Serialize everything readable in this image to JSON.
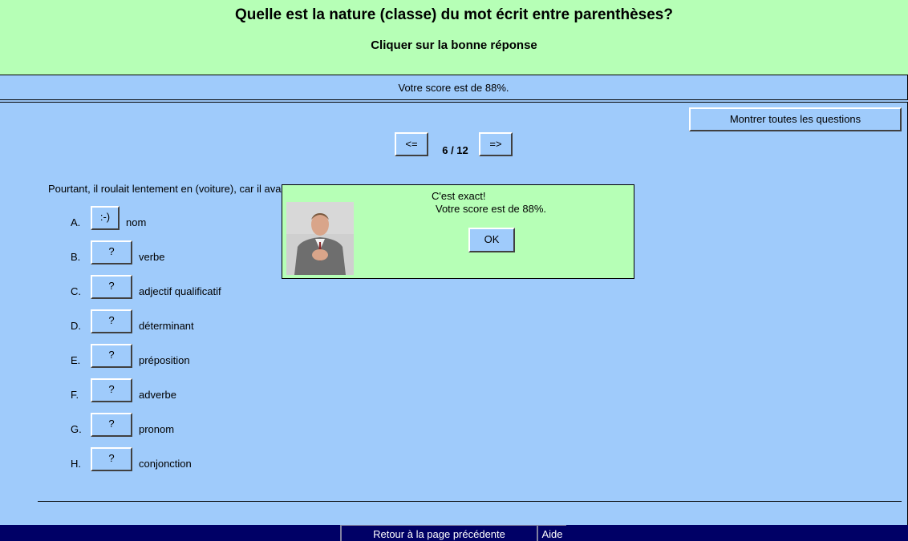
{
  "header": {
    "title": "Quelle est la nature (classe) du mot écrit entre parenthèses?",
    "subtitle": "Cliquer sur la bonne réponse"
  },
  "score_text": "Votre score est de 88%.",
  "toolbar": {
    "show_all_label": "Montrer toutes les questions",
    "prev_label": "<=",
    "next_label": "=>",
    "counter": "6 / 12"
  },
  "question": {
    "text": "Pourtant, il roulait lentement en (voiture), car il avait"
  },
  "options": [
    {
      "letter": "A.",
      "button": ":-)",
      "text": "nom"
    },
    {
      "letter": "B.",
      "button": "?",
      "text": "verbe"
    },
    {
      "letter": "C.",
      "button": "?",
      "text": "adjectif qualificatif"
    },
    {
      "letter": "D.",
      "button": "?",
      "text": "déterminant"
    },
    {
      "letter": "E.",
      "button": "?",
      "text": "préposition"
    },
    {
      "letter": "F.",
      "button": "?",
      "text": "adverbe"
    },
    {
      "letter": "G.",
      "button": "?",
      "text": "pronom"
    },
    {
      "letter": "H.",
      "button": "?",
      "text": "conjonction"
    }
  ],
  "footer": {
    "back_label": "Retour à la page précédente",
    "help_label": "Aide"
  },
  "dialog": {
    "title": "C'est exact!",
    "message": "Votre score est de 88%.",
    "ok_label": "OK"
  },
  "colors": {
    "header_bg": "#b6ffb6",
    "body_bg": "#9fcbfb",
    "footer_bg": "#000066"
  }
}
